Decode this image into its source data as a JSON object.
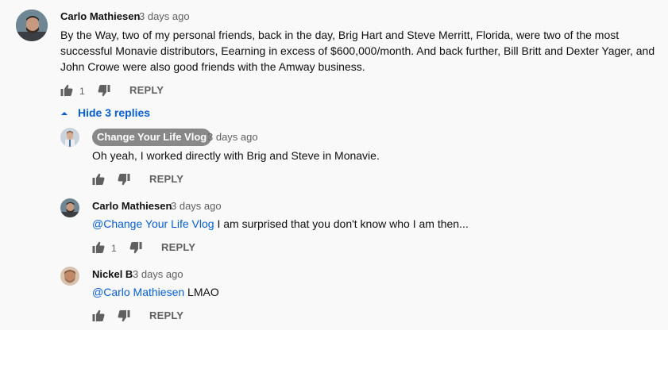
{
  "top_comment": {
    "author": "Carlo Mathiesen",
    "time": "3 days ago",
    "text": "By the Way, two of my personal friends, back in the day, Brig Hart and Steve Merritt, Florida, were two of the most successful Monavie distributors, Eearning in excess of $600,000/month. And back further, Bill Britt and Dexter Yager, and John Crowe were also good friends with the Amway business.",
    "like_count": "1",
    "reply_label": "REPLY",
    "avatar_icon": "person-avatar"
  },
  "replies_toggle": {
    "label": "Hide 3 replies",
    "icon": "caret-up-icon"
  },
  "replies": [
    {
      "author": "Change Your Life Vlog",
      "author_is_channel_owner": true,
      "time": "3 days ago",
      "text": "Oh yeah, I worked directly with Brig and Steve in Monavie.",
      "like_count": "",
      "reply_label": "REPLY"
    },
    {
      "author": "Carlo Mathiesen",
      "time": "3 days ago",
      "mention": "@Change Your Life Vlog",
      "text": " I am surprised that you don't know who I am then...",
      "like_count": "1",
      "reply_label": "REPLY"
    },
    {
      "author": "Nickel B",
      "time": "3 days ago",
      "mention": "@Carlo Mathiesen",
      "text": " LMAO",
      "like_count": "",
      "reply_label": "REPLY"
    }
  ],
  "colors": {
    "background": "#f9f9f9",
    "link": "#065fd4",
    "owner_chip": "#888888",
    "secondary_text": "#606060"
  }
}
